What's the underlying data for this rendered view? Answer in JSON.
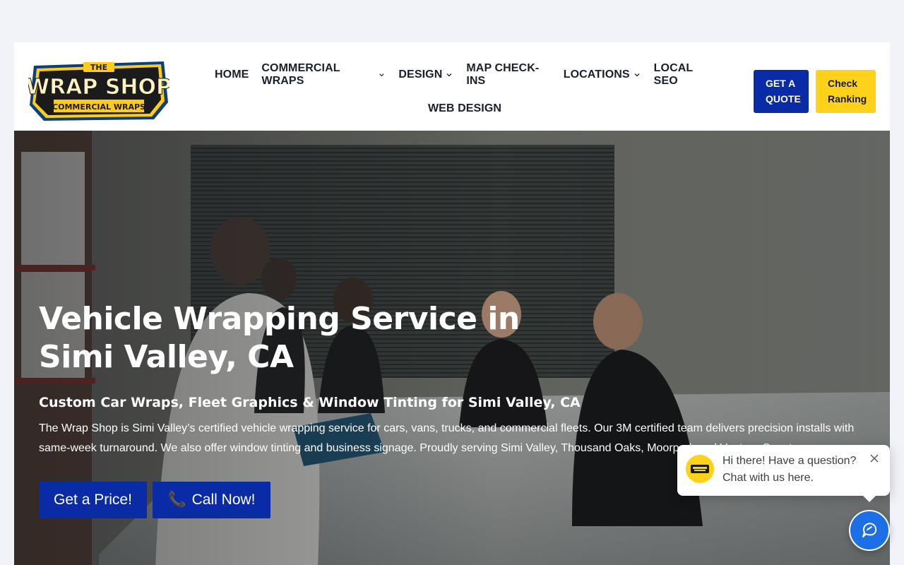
{
  "header": {
    "logo_top": "THE",
    "logo_main": "WRAP SHOP",
    "logo_sub": "COMMERCIAL WRAPS",
    "nav_row1": [
      {
        "label": "HOME",
        "dropdown": false
      },
      {
        "label": "COMMERCIAL WRAPS",
        "dropdown": true
      },
      {
        "label": "DESIGN",
        "dropdown": true
      },
      {
        "label": "MAP CHECK-INS",
        "dropdown": false
      },
      {
        "label": "LOCATIONS",
        "dropdown": true
      },
      {
        "label": "LOCAL SEO",
        "dropdown": false
      }
    ],
    "nav_row2": [
      {
        "label": "WEB DESIGN",
        "dropdown": false
      }
    ],
    "quote_line1": "GET A",
    "quote_line2": "QUOTE",
    "rank_line1": "Check",
    "rank_line2": "Ranking"
  },
  "hero": {
    "title_line1": "Vehicle Wrapping Service in",
    "title_line2": "Simi Valley, CA",
    "subtitle": "Custom Car Wraps, Fleet Graphics & Window Tinting for Simi Valley, CA",
    "description_line1": "The Wrap Shop is Simi Valley’s certified vehicle wrapping service for cars, vans, trucks, and commercial fleets. Our 3M certified team delivers precision installs with",
    "description_line2": "same-week turnaround. We also offer window tinting and business signage. Proudly serving Simi Valley, Thousand Oaks, Moorpark and Ventura County.",
    "price_button": "Get a Price!",
    "call_icon": "📞",
    "call_button": "Call Now!"
  },
  "chat": {
    "line1": "Hi there! Have a question?",
    "line2": "Chat with us here."
  },
  "colors": {
    "brand_blue": "#0a2ba6",
    "brand_yellow": "#ffd21a",
    "chat_blue": "#1d6fe6"
  }
}
